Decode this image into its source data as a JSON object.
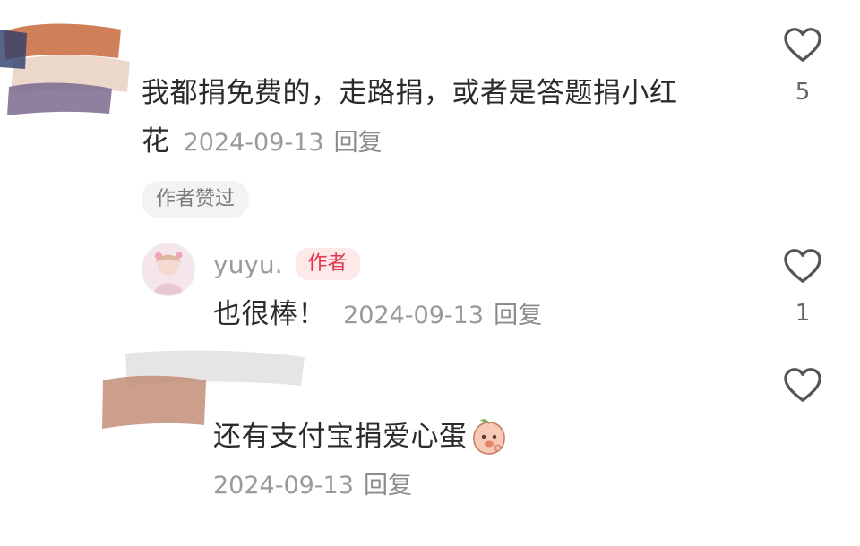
{
  "comments": [
    {
      "text_line1": "我都捐免费的，走路捐，或者是答题捐小红",
      "text_line2": "花",
      "date": "2024-09-13",
      "reply_label": "回复",
      "like_count": "5",
      "chip": "作者赞过",
      "avatar": "redacted-avatar"
    },
    {
      "username": "yuyu.",
      "badge": "作者",
      "text": "也很棒！",
      "date": "2024-09-13",
      "reply_label": "回复",
      "like_count": "1",
      "avatar": "user-avatar"
    },
    {
      "text": "还有支付宝捐爱心蛋",
      "emoji": "peach-emoji",
      "date": "2024-09-13",
      "reply_label": "回复",
      "like_count": "",
      "avatar": "redacted-avatar"
    }
  ],
  "colors": {
    "badge_text": "#e3364a",
    "badge_bg": "#fde8ea",
    "meta_text": "#9a9a9a",
    "heart_stroke": "#555555"
  }
}
